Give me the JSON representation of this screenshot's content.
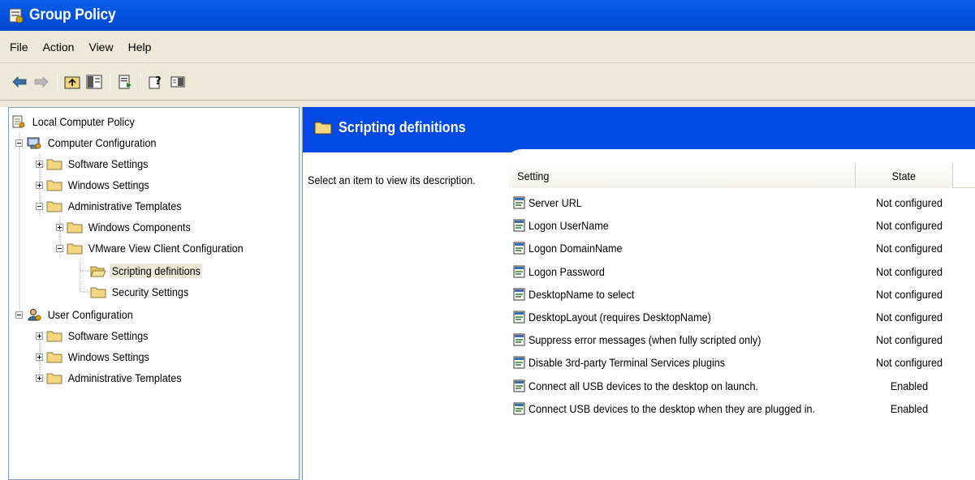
{
  "window": {
    "title": "Group Policy"
  },
  "menu": [
    "File",
    "Action",
    "View",
    "Help"
  ],
  "tree": {
    "root": "Local Computer Policy",
    "computer_config": "Computer Configuration",
    "cc_software": "Software Settings",
    "cc_windows": "Windows Settings",
    "cc_admin": "Administrative Templates",
    "cc_admin_wincomp": "Windows Components",
    "cc_admin_vmware": "VMware View Client Configuration",
    "cc_admin_vmware_scripting": "Scripting definitions",
    "cc_admin_vmware_security": "Security Settings",
    "user_config": "User Configuration",
    "uc_software": "Software Settings",
    "uc_windows": "Windows Settings",
    "uc_admin": "Administrative Templates"
  },
  "details": {
    "header_title": "Scripting definitions",
    "description": "Select an item to view its description.",
    "columns": {
      "setting": "Setting",
      "state": "State"
    },
    "rows": [
      {
        "setting": "Server URL",
        "state": "Not configured"
      },
      {
        "setting": "Logon UserName",
        "state": "Not configured"
      },
      {
        "setting": "Logon DomainName",
        "state": "Not configured"
      },
      {
        "setting": "Logon Password",
        "state": "Not configured"
      },
      {
        "setting": "DesktopName to select",
        "state": "Not configured"
      },
      {
        "setting": "DesktopLayout (requires DesktopName)",
        "state": "Not configured"
      },
      {
        "setting": "Suppress error messages (when fully scripted only)",
        "state": "Not configured"
      },
      {
        "setting": "Disable 3rd-party Terminal Services plugins",
        "state": "Not configured"
      },
      {
        "setting": "Connect all USB devices to the desktop on launch.",
        "state": "Enabled"
      },
      {
        "setting": "Connect USB devices to the desktop when they are plugged in.",
        "state": "Enabled"
      }
    ]
  },
  "colors": {
    "title_blue": "#0254e0",
    "band_blue": "#0249e6",
    "chrome": "#ece9d8",
    "folder": "#f4d680"
  }
}
